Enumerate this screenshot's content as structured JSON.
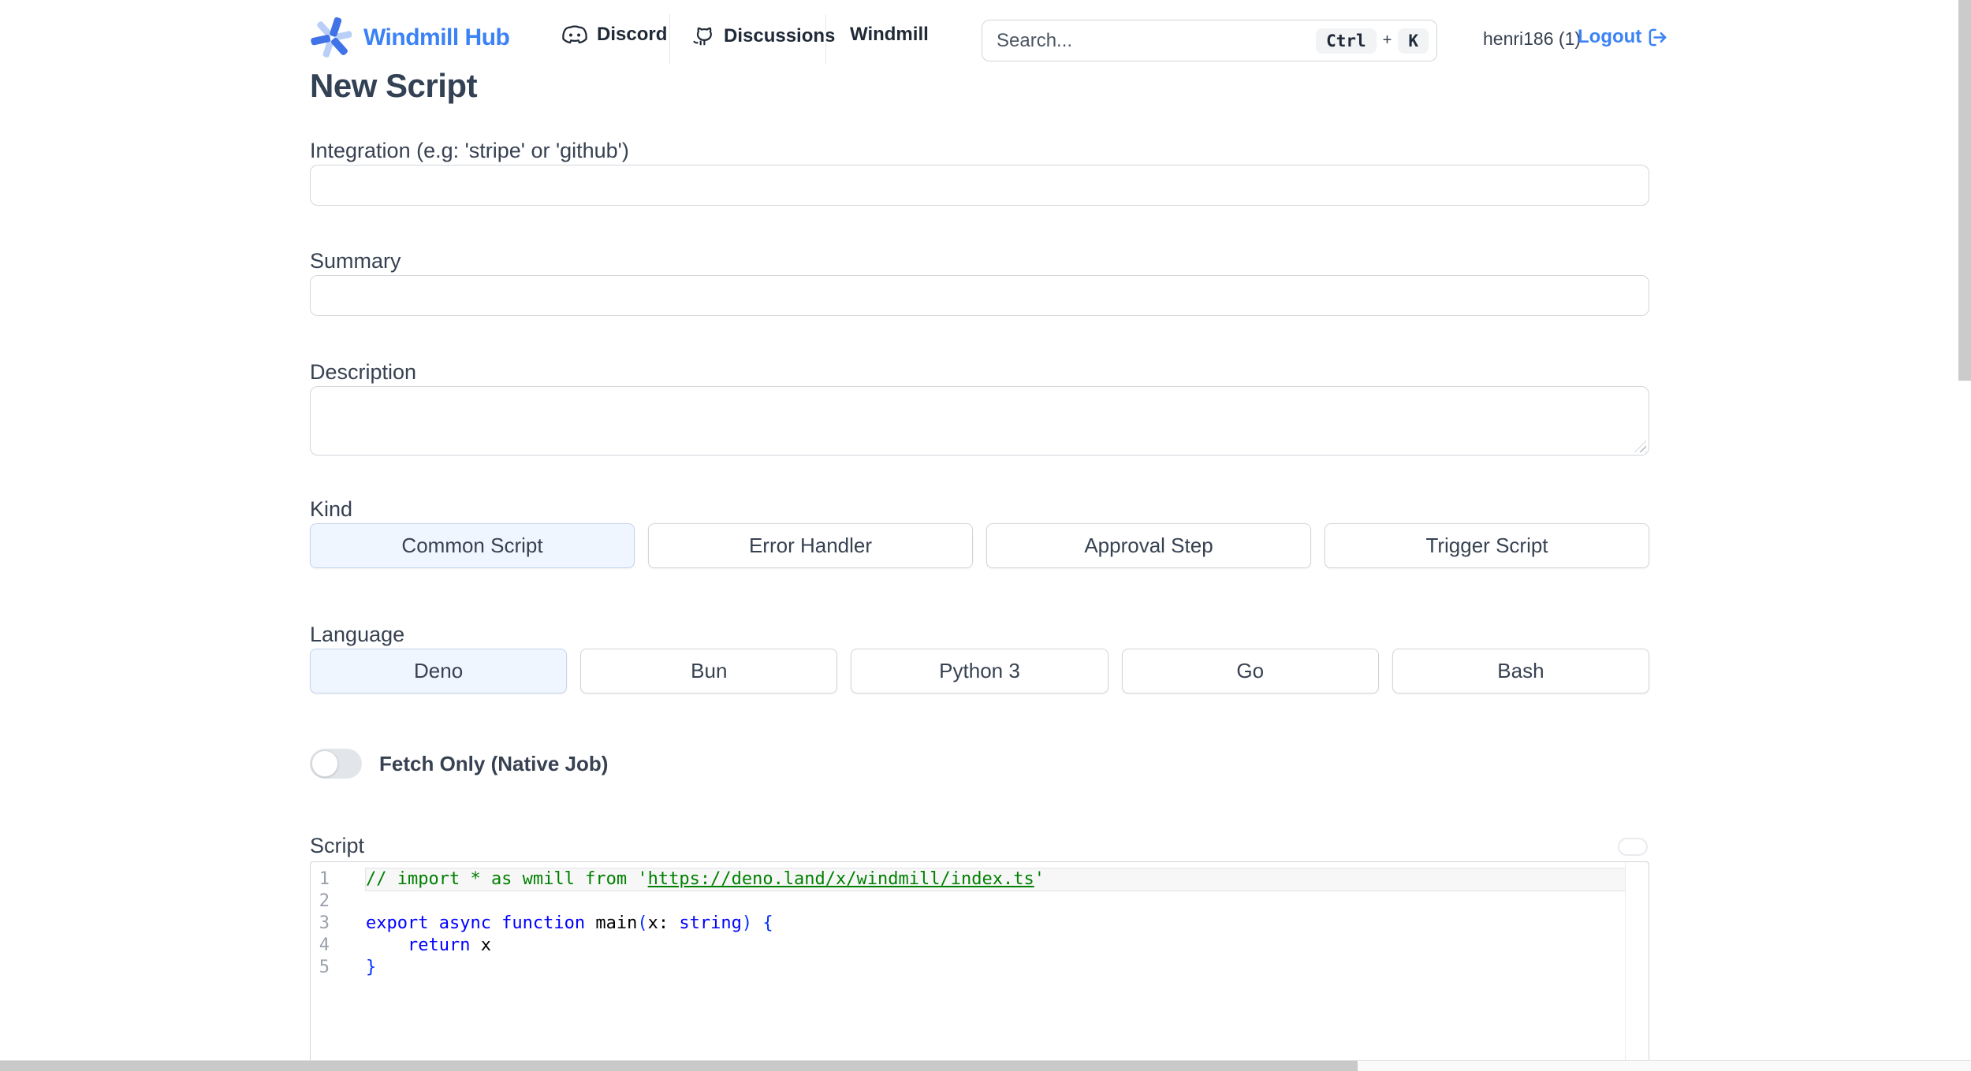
{
  "header": {
    "logo_text": "Windmill Hub",
    "nav": [
      {
        "label": "Discord",
        "icon": "discord-icon"
      },
      {
        "label": "Discussions",
        "icon": "github-icon"
      },
      {
        "label": "Windmill",
        "icon": null
      }
    ],
    "search": {
      "placeholder": "Search...",
      "keys": [
        "Ctrl",
        "K"
      ],
      "key_separator": "+"
    },
    "user": "henri186 (1)",
    "logout_label": "Logout"
  },
  "page": {
    "title": "New Script"
  },
  "form": {
    "integration": {
      "label": "Integration (e.g: 'stripe' or 'github')",
      "value": ""
    },
    "summary": {
      "label": "Summary",
      "value": ""
    },
    "description": {
      "label": "Description",
      "value": ""
    },
    "kind": {
      "label": "Kind",
      "options": [
        "Common Script",
        "Error Handler",
        "Approval Step",
        "Trigger Script"
      ],
      "selected": "Common Script"
    },
    "language": {
      "label": "Language",
      "options": [
        "Deno",
        "Bun",
        "Python 3",
        "Go",
        "Bash"
      ],
      "selected": "Deno"
    },
    "fetch_only": {
      "label": "Fetch Only (Native Job)",
      "enabled": false
    },
    "script": {
      "label": "Script"
    }
  },
  "editor": {
    "lines": [
      {
        "num": "1",
        "active": true,
        "tokens": [
          {
            "text": "// import * as wmill from '",
            "style": "comment"
          },
          {
            "text": "https://deno.land/x/windmill/index.ts",
            "style": "link"
          },
          {
            "text": "'",
            "style": "comment"
          }
        ]
      },
      {
        "num": "2",
        "active": false,
        "tokens": []
      },
      {
        "num": "3",
        "active": false,
        "tokens": [
          {
            "text": "export async function",
            "style": "kw"
          },
          {
            "text": " main",
            "style": "plain"
          },
          {
            "text": "(",
            "style": "br"
          },
          {
            "text": "x",
            "style": "plain"
          },
          {
            "text": ": ",
            "style": "plain"
          },
          {
            "text": "string",
            "style": "kw"
          },
          {
            "text": ")",
            "style": "br"
          },
          {
            "text": " ",
            "style": "plain"
          },
          {
            "text": "{",
            "style": "br"
          }
        ]
      },
      {
        "num": "4",
        "active": false,
        "tokens": [
          {
            "text": "    ",
            "style": "plain"
          },
          {
            "text": "return",
            "style": "kw"
          },
          {
            "text": " x",
            "style": "plain"
          }
        ]
      },
      {
        "num": "5",
        "active": false,
        "tokens": [
          {
            "text": "}",
            "style": "br"
          }
        ]
      }
    ]
  },
  "colors": {
    "accent_blue": "#3b82f6",
    "selected_option_bg": "#eff6ff",
    "comment_green": "#008000",
    "keyword_blue": "#0000ff",
    "bracket_blue": "#0431fa",
    "scrollbar_gray": "#cbcbcb"
  }
}
